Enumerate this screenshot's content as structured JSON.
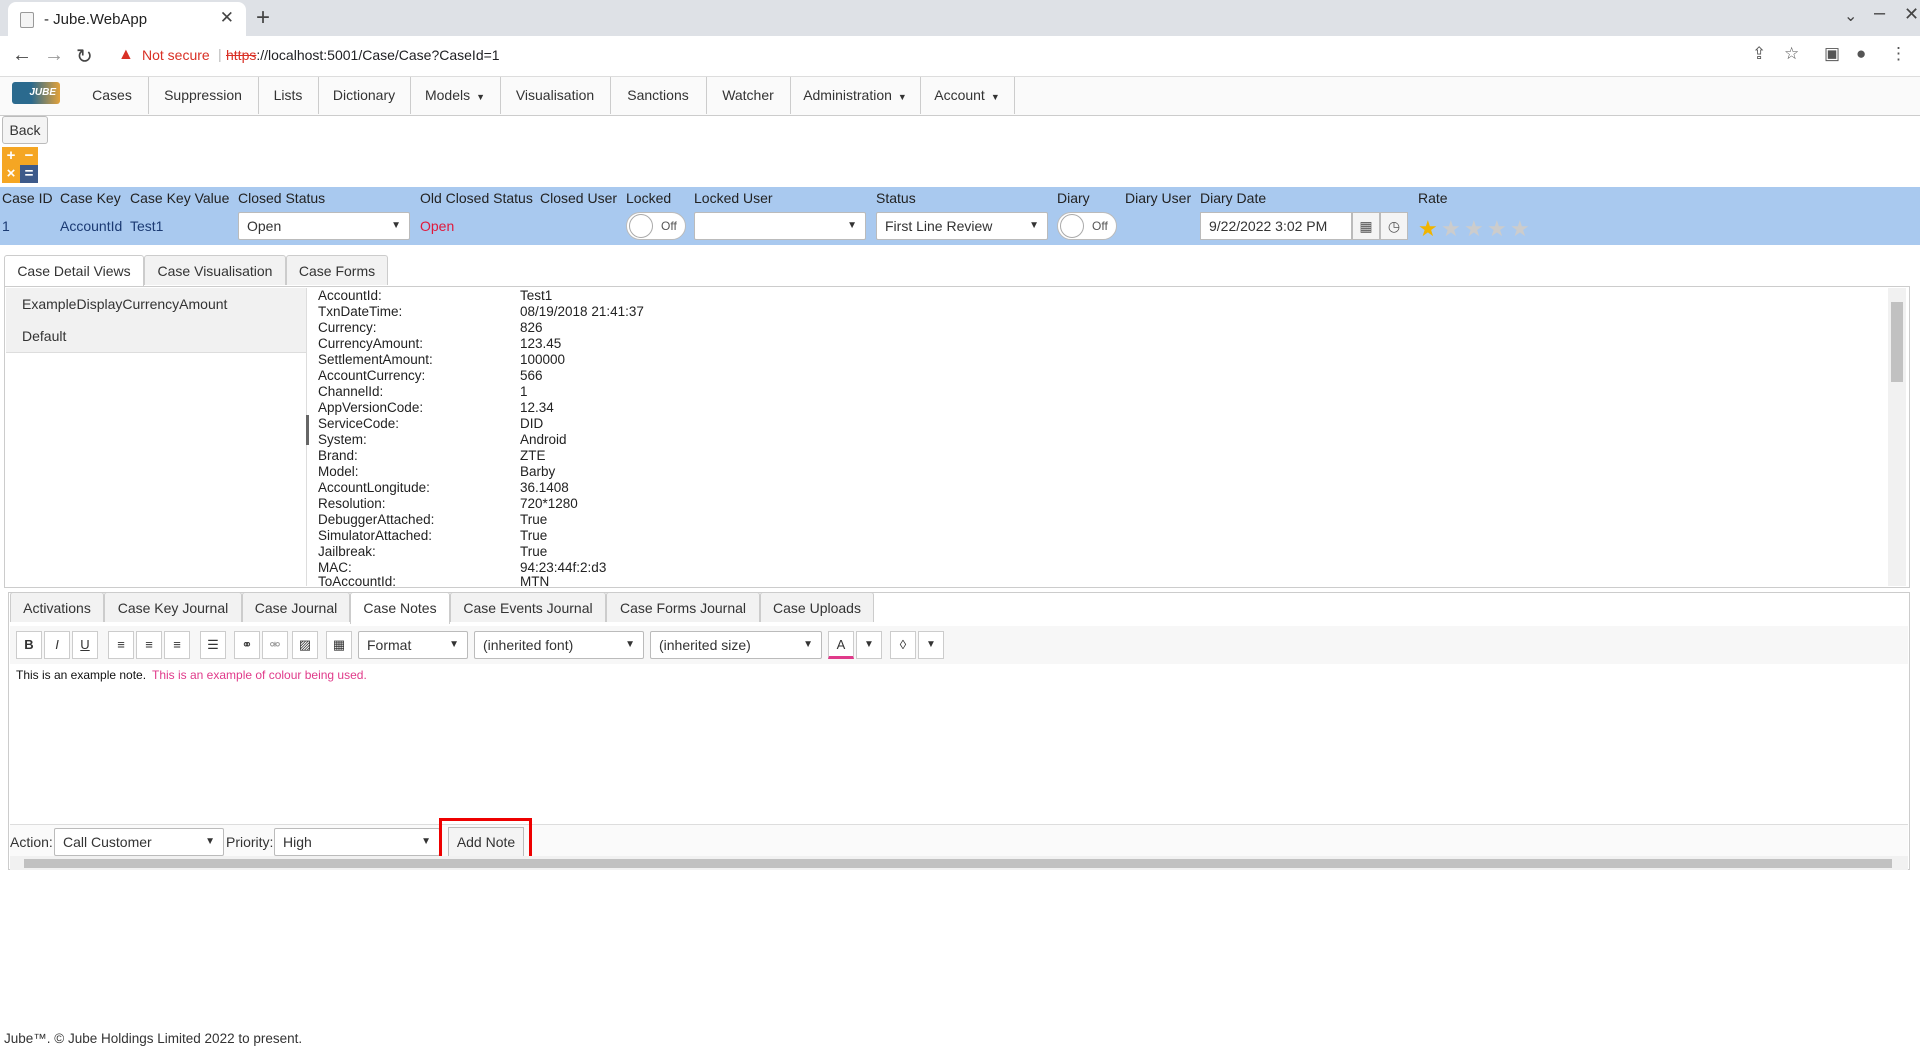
{
  "browser": {
    "tab_title": "- Jube.WebApp",
    "not_secure": "Not secure",
    "url_scheme": "https",
    "url_rest": "://localhost:5001/Case/Case?CaseId=1"
  },
  "menu": {
    "logo": "JUBE",
    "items": [
      "Cases",
      "Suppression",
      "Lists",
      "Dictionary",
      "Models",
      "Visualisation",
      "Sanctions",
      "Watcher",
      "Administration",
      "Account"
    ]
  },
  "back_label": "Back",
  "header": {
    "labels": [
      "Case ID",
      "Case Key",
      "Case Key Value",
      "Closed Status",
      "Old Closed Status",
      "Closed User",
      "Locked",
      "Locked User",
      "Status",
      "Diary",
      "Diary User",
      "Diary Date",
      "Rate"
    ],
    "case_id": "1",
    "case_key": "AccountId",
    "case_key_value": "Test1",
    "closed_status": "Open",
    "old_closed_status": "Open",
    "locked": "Off",
    "locked_user": "",
    "status": "First Line Review",
    "diary": "Off",
    "diary_date": "9/22/2022 3:02 PM",
    "rating": 1,
    "old_closed_color": "#e0193c"
  },
  "tabs": [
    "Case Detail Views",
    "Case Visualisation",
    "Case Forms"
  ],
  "views": [
    "ExampleDisplayCurrencyAmount",
    "Default"
  ],
  "fields": [
    {
      "k": "AccountId:",
      "v": "Test1"
    },
    {
      "k": "TxnDateTime:",
      "v": "08/19/2018 21:41:37"
    },
    {
      "k": "Currency:",
      "v": "826"
    },
    {
      "k": "CurrencyAmount:",
      "v": "123.45"
    },
    {
      "k": "SettlementAmount:",
      "v": "100000"
    },
    {
      "k": "AccountCurrency:",
      "v": "566"
    },
    {
      "k": "ChannelId:",
      "v": "1"
    },
    {
      "k": "AppVersionCode:",
      "v": "12.34"
    },
    {
      "k": "ServiceCode:",
      "v": "DID"
    },
    {
      "k": "System:",
      "v": "Android"
    },
    {
      "k": "Brand:",
      "v": "ZTE"
    },
    {
      "k": "Model:",
      "v": "Barby"
    },
    {
      "k": "AccountLongitude:",
      "v": "36.1408"
    },
    {
      "k": "Resolution:",
      "v": "720*1280"
    },
    {
      "k": "DebuggerAttached:",
      "v": "True"
    },
    {
      "k": "SimulatorAttached:",
      "v": "True"
    },
    {
      "k": "Jailbreak:",
      "v": "True"
    },
    {
      "k": "MAC:",
      "v": "94:23:44f:2:d3"
    },
    {
      "k": "ToAccountId:",
      "v": "MTN"
    }
  ],
  "bottom_tabs": [
    "Activations",
    "Case Key Journal",
    "Case Journal",
    "Case Notes",
    "Case Events Journal",
    "Case Forms Journal",
    "Case Uploads"
  ],
  "editor": {
    "format": "Format",
    "font": "(inherited font)",
    "size": "(inherited size)",
    "note_text": "This is an example note.",
    "note_colored": "This is an example of colour being used."
  },
  "form": {
    "action_label": "Action:",
    "action_value": "Call Customer",
    "priority_label": "Priority:",
    "priority_value": "High",
    "add_note": "Add Note"
  },
  "footer": "Jube™. © Jube Holdings Limited 2022 to present."
}
